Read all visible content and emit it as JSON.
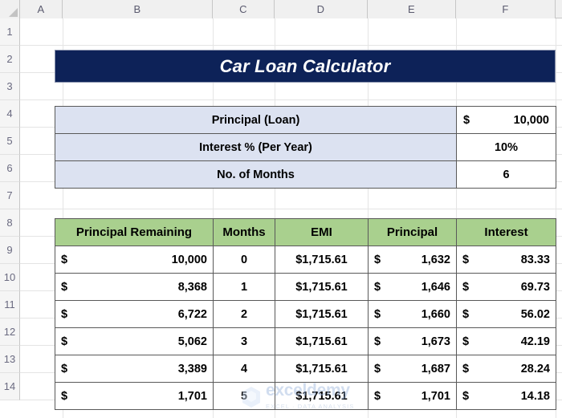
{
  "spreadsheet": {
    "column_headers": [
      "A",
      "B",
      "C",
      "D",
      "E",
      "F"
    ],
    "row_headers": [
      "1",
      "2",
      "3",
      "4",
      "5",
      "6",
      "7",
      "8",
      "9",
      "10",
      "11",
      "12",
      "13",
      "14"
    ],
    "select_all_icon": "select-all-triangle-icon"
  },
  "title": {
    "text": "Car Loan Calculator",
    "background_color": "#0D2258",
    "text_color": "#FFFFFF"
  },
  "inputs": {
    "header_fill": "#DCE2F1",
    "rows": [
      {
        "label": "Principal (Loan)",
        "currency": "$",
        "value": "10,000"
      },
      {
        "label": "Interest % (Per Year)",
        "currency": "",
        "value": "10%"
      },
      {
        "label": "No. of Months",
        "currency": "",
        "value": "6"
      }
    ]
  },
  "schedule": {
    "header_fill": "#A9D08E",
    "columns": [
      "Principal Remaining",
      "Months",
      "EMI",
      "Principal",
      "Interest"
    ],
    "rows": [
      {
        "remaining_currency": "$",
        "remaining": "10,000",
        "month": "0",
        "emi": "$1,715.61",
        "principal_currency": "$",
        "principal": "1,632",
        "interest_currency": "$",
        "interest": "83.33"
      },
      {
        "remaining_currency": "$",
        "remaining": "8,368",
        "month": "1",
        "emi": "$1,715.61",
        "principal_currency": "$",
        "principal": "1,646",
        "interest_currency": "$",
        "interest": "69.73"
      },
      {
        "remaining_currency": "$",
        "remaining": "6,722",
        "month": "2",
        "emi": "$1,715.61",
        "principal_currency": "$",
        "principal": "1,660",
        "interest_currency": "$",
        "interest": "56.02"
      },
      {
        "remaining_currency": "$",
        "remaining": "5,062",
        "month": "3",
        "emi": "$1,715.61",
        "principal_currency": "$",
        "principal": "1,673",
        "interest_currency": "$",
        "interest": "42.19"
      },
      {
        "remaining_currency": "$",
        "remaining": "3,389",
        "month": "4",
        "emi": "$1,715.61",
        "principal_currency": "$",
        "principal": "1,687",
        "interest_currency": "$",
        "interest": "28.24"
      },
      {
        "remaining_currency": "$",
        "remaining": "1,701",
        "month": "5",
        "emi": "$1,715.61",
        "principal_currency": "$",
        "principal": "1,701",
        "interest_currency": "$",
        "interest": "14.18"
      }
    ]
  },
  "watermark": {
    "name": "exceldemy",
    "subtitle": "EXCEL · DATA ANALYSIS",
    "color": "#9BB6DD"
  }
}
